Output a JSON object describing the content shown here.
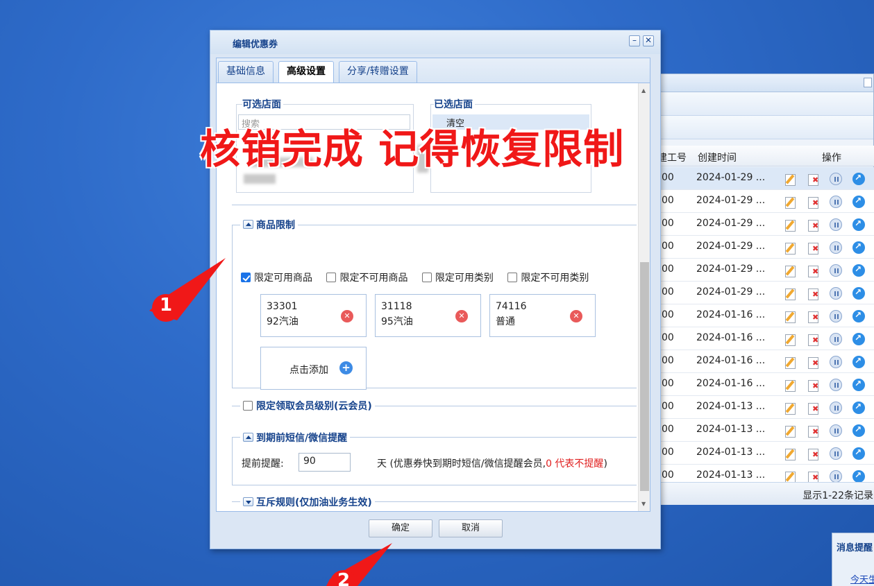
{
  "background_window": {
    "columns": [
      "建工号",
      "创建时间",
      "操作"
    ],
    "rows": [
      {
        "c1": "00",
        "date": "2024-01-29 ..."
      },
      {
        "c1": "00",
        "date": "2024-01-29 ..."
      },
      {
        "c1": "00",
        "date": "2024-01-29 ..."
      },
      {
        "c1": "00",
        "date": "2024-01-29 ..."
      },
      {
        "c1": "00",
        "date": "2024-01-29 ..."
      },
      {
        "c1": "00",
        "date": "2024-01-29 ..."
      },
      {
        "c1": "00",
        "date": "2024-01-16 ..."
      },
      {
        "c1": "00",
        "date": "2024-01-16 ..."
      },
      {
        "c1": "00",
        "date": "2024-01-16 ..."
      },
      {
        "c1": "00",
        "date": "2024-01-16 ..."
      },
      {
        "c1": "00",
        "date": "2024-01-13 ..."
      },
      {
        "c1": "00",
        "date": "2024-01-13 ..."
      },
      {
        "c1": "00",
        "date": "2024-01-13 ..."
      },
      {
        "c1": "00",
        "date": "2024-01-13 ..."
      }
    ],
    "footer": "显示1-22条记录"
  },
  "message_window": {
    "title": "消息提醒",
    "link": "今天生"
  },
  "dialog": {
    "title": "编辑优惠券",
    "tabs": [
      "基础信息",
      "高级设置",
      "分享/转赠设置"
    ],
    "stores": {
      "available_label": "可选店面",
      "available_placeholder": "搜索",
      "selected_label": "已选店面",
      "clear_label": "清空"
    },
    "product_limit": {
      "legend": "商品限制",
      "checkboxes": [
        {
          "label": "限定可用商品",
          "checked": true
        },
        {
          "label": "限定不可用商品",
          "checked": false
        },
        {
          "label": "限定可用类别",
          "checked": false
        },
        {
          "label": "限定不可用类别",
          "checked": false
        }
      ],
      "products": [
        {
          "code": "33301",
          "name": "92汽油"
        },
        {
          "code": "31118",
          "name": "95汽油"
        },
        {
          "code": "74116",
          "name": "普通"
        }
      ],
      "add_label": "点击添加"
    },
    "member_level": {
      "label": "限定领取会员级别(云会员)",
      "checked": false
    },
    "reminder": {
      "legend": "到期前短信/微信提醒",
      "label": "提前提醒:",
      "days": "90",
      "note_prefix": "天 (优惠券快到期时短信/微信提醒会员,",
      "note_red": "0 代表不提醒",
      "note_suffix": ")"
    },
    "exclusive": {
      "legend": "互斥规则(仅加油业务生效)"
    },
    "ok_label": "确定",
    "cancel_label": "取消"
  },
  "annotation": {
    "overlay_text": "核销完成  记得恢复限制",
    "marker1": "1",
    "marker2": "2",
    "color": "#f01818"
  }
}
